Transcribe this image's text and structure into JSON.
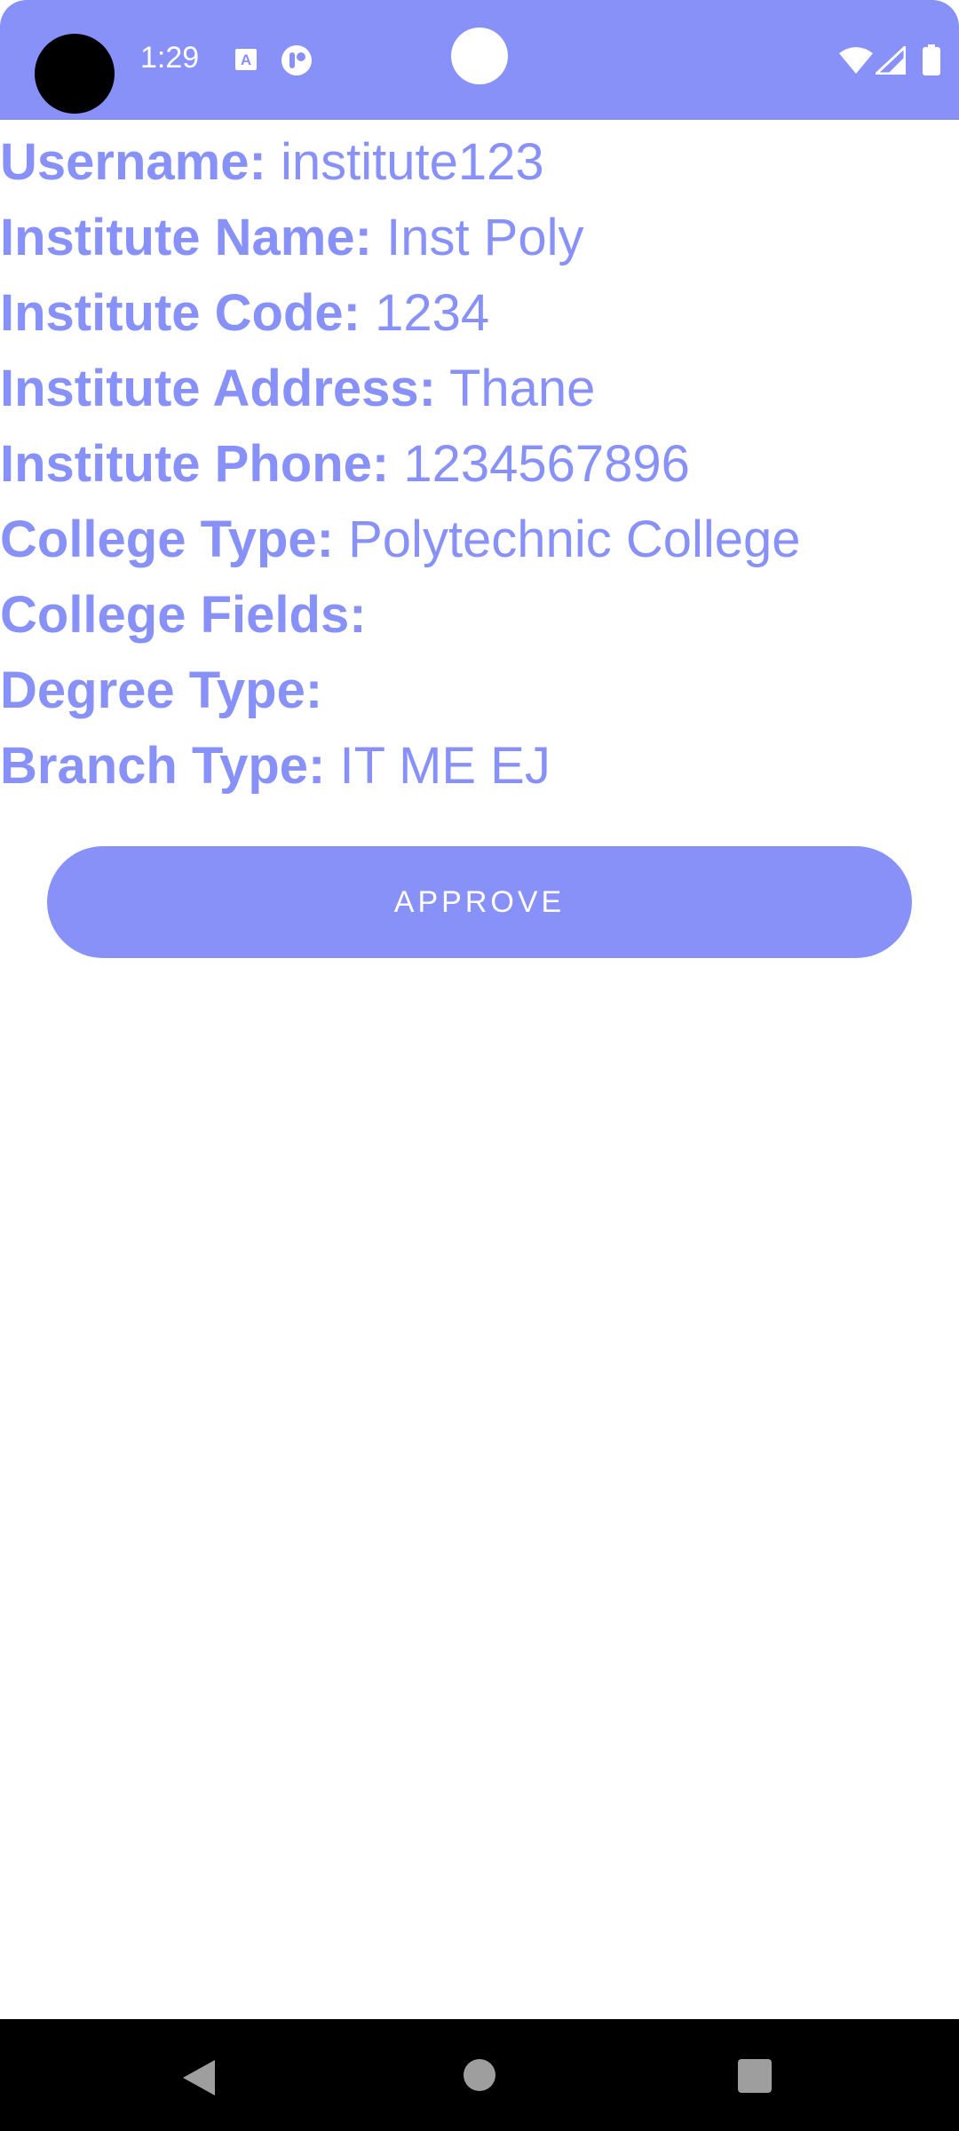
{
  "status_bar": {
    "time": "1:29",
    "icons": [
      "camera-cutout",
      "a-notification-icon",
      "app-notification-icon",
      "wifi-icon",
      "cell-signal-icon",
      "battery-icon"
    ],
    "background_color": "#8891f8"
  },
  "details": [
    {
      "label": "Username:",
      "value": "institute123"
    },
    {
      "label": "Institute Name:",
      "value": "Inst Poly"
    },
    {
      "label": "Institute Code:",
      "value": "1234"
    },
    {
      "label": "Institute Address:",
      "value": "Thane"
    },
    {
      "label": "Institute Phone:",
      "value": "1234567896"
    },
    {
      "label": "College Type:",
      "value": "Polytechnic College"
    },
    {
      "label": "College Fields:",
      "value": ""
    },
    {
      "label": "Degree Type:",
      "value": ""
    },
    {
      "label": "Branch Type:",
      "value": "IT ME EJ"
    }
  ],
  "actions": {
    "approve_label": "APPROVE"
  },
  "nav_bar": {
    "icons": [
      "back-icon",
      "home-icon",
      "recents-icon"
    ]
  },
  "colors": {
    "accent": "#8891f8",
    "background": "#ffffff",
    "nav_background": "#000000"
  }
}
